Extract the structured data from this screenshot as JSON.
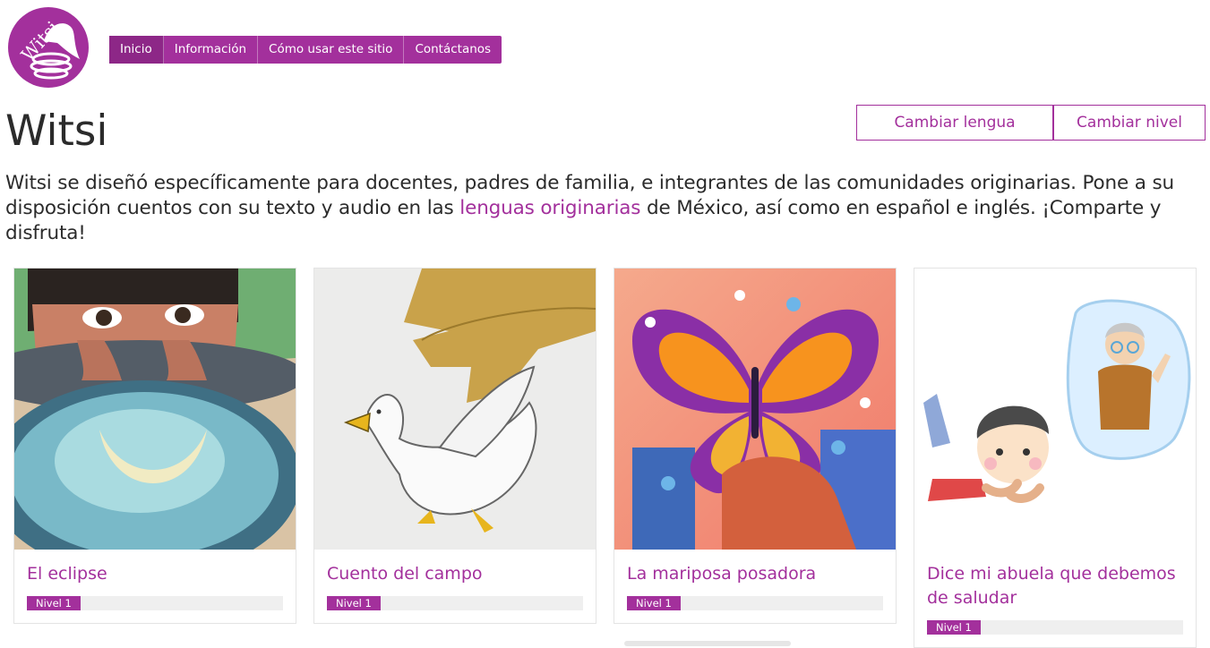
{
  "brand": {
    "logo_text": "Witsi",
    "accent": "#a3309c"
  },
  "nav": [
    "Inicio",
    "Información",
    "Cómo usar este sitio",
    "Contáctanos"
  ],
  "page_title": "Witsi",
  "actions": {
    "change_language": "Cambiar lengua",
    "change_level": "Cambiar nivel"
  },
  "intro": {
    "before": "Witsi se diseñó específicamente para docentes, padres de familia, e integrantes de las comunidades originarias. Pone a su disposición cuentos con su texto y audio en las ",
    "link": "lenguas originarias",
    "after": " de México, así como en español e inglés. ¡Comparte y disfruta!"
  },
  "stories": [
    {
      "title": "El eclipse",
      "level": "Nivel 1",
      "image": "boy-looking-at-water-bowl"
    },
    {
      "title": "Cuento del campo",
      "level": "Nivel 1",
      "image": "duck-and-hands-drawing"
    },
    {
      "title": "La mariposa posadora",
      "level": "Nivel 1",
      "image": "monarch-butterfly-on-hand"
    },
    {
      "title": "Dice mi abuela que debemos de saludar",
      "level": "Nivel 1",
      "image": "boy-thinking-of-grandmother"
    }
  ]
}
